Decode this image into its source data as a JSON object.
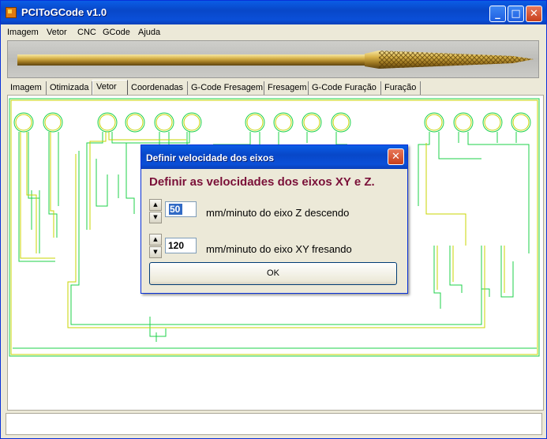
{
  "window": {
    "title": "PCIToGCode  v1.0",
    "controls": {
      "minimize": "_",
      "maximize": "□",
      "close": "✕"
    }
  },
  "menu": [
    "Imagem",
    "Vetor",
    "CNC",
    "GCode",
    "Ajuda"
  ],
  "tabs": [
    "Imagem",
    "Otimizada",
    "Vetor",
    "Coordenadas",
    "G-Code Fresagem",
    "Fresagem",
    "G-Code Furação",
    "Furação"
  ],
  "active_tab": "Vetor",
  "dialog": {
    "title": "Definir velocidade dos eixos",
    "heading": "Definir as velocidades dos eixos XY e Z.",
    "z_speed": {
      "value": "50",
      "label": "mm/minuto do eixo Z descendo"
    },
    "xy_speed": {
      "value": "120",
      "label": "mm/minuto do eixo XY fresando"
    },
    "ok_label": "OK"
  },
  "colors": {
    "titlebar": "#0a4fd8",
    "trace_yellow": "#c8d400",
    "trace_green": "#1cd24a",
    "heading": "#7a1038"
  },
  "icons": {
    "spin_up": "triangle-up",
    "spin_down": "triangle-down",
    "banner": "carbide-end-mill"
  }
}
